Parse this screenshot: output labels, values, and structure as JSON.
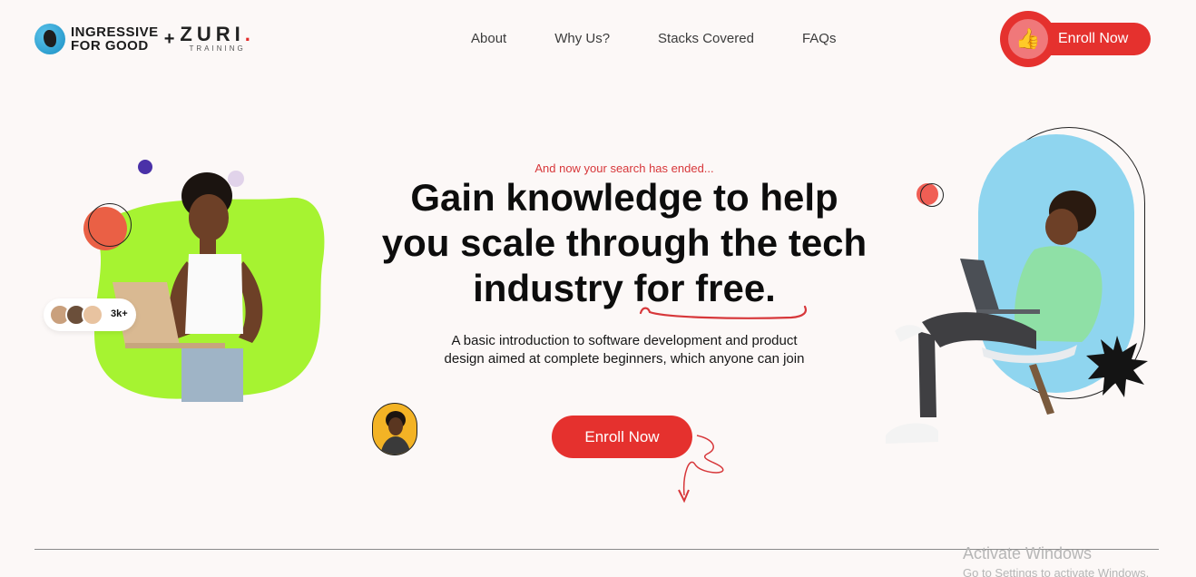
{
  "header": {
    "logo": {
      "brand_line1": "INGRESSIVE",
      "brand_line2": "FOR GOOD",
      "plus": "+",
      "partner": "ZURI",
      "partner_dot": ".",
      "partner_sub": "TRAINING"
    },
    "nav": [
      {
        "label": "About"
      },
      {
        "label": "Why Us?"
      },
      {
        "label": "Stacks Covered"
      },
      {
        "label": "FAQs"
      }
    ],
    "cta_label": "Enroll Now"
  },
  "hero": {
    "eyebrow": "And now your search has ended...",
    "headline": "Gain knowledge to help you scale through the tech industry for free.",
    "subtext": "A basic introduction to software development and product design aimed at complete beginners, which anyone can join",
    "cta_label": "Enroll Now",
    "community_count": "3k+"
  },
  "colors": {
    "accent": "#e5312e",
    "lime": "#a6f331",
    "sky": "#8fd5ef",
    "purple": "#4a31a8",
    "background": "#fcf8f7"
  },
  "watermark": {
    "title": "Activate Windows",
    "subtitle": "Go to Settings to activate Windows."
  }
}
